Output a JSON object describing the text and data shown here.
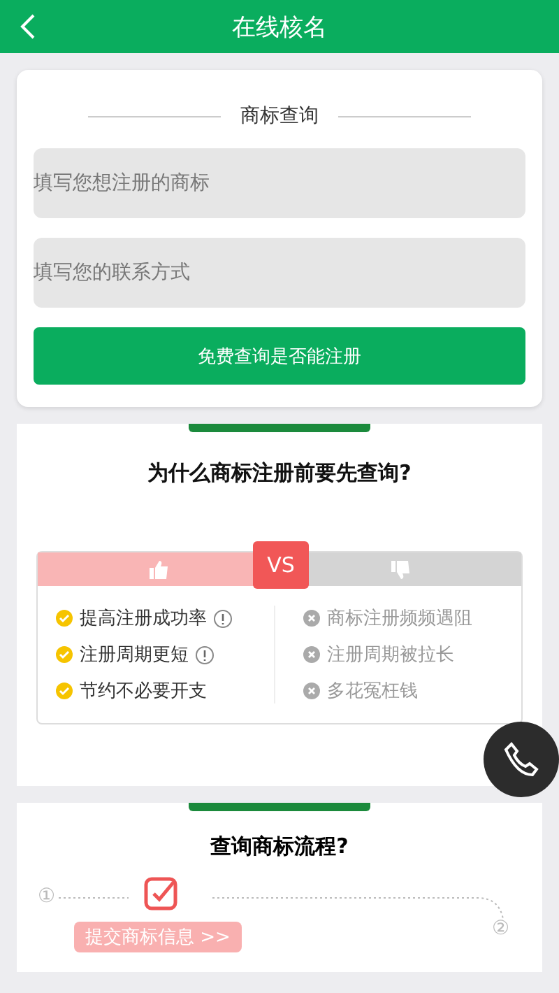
{
  "header": {
    "title": "在线核名"
  },
  "query_card": {
    "title": "商标查询",
    "fields": [
      {
        "placeholder": "填写您想注册的商标"
      },
      {
        "placeholder": "填写您的联系方式"
      }
    ],
    "button": "免费查询是否能注册"
  },
  "why_card": {
    "title": "为什么商标注册前要先查询?",
    "vs": "VS",
    "pros": [
      {
        "text": "提高注册成功率",
        "info": true
      },
      {
        "text": "注册周期更短",
        "info": true
      },
      {
        "text": "节约不必要开支",
        "info": false
      }
    ],
    "cons": [
      {
        "text": "商标注册频频遇阻"
      },
      {
        "text": "注册周期被拉长"
      },
      {
        "text": "多花冤枉钱"
      }
    ]
  },
  "flow_card": {
    "title": "查询商标流程?",
    "steps": [
      {
        "number": "①",
        "label": "提交商标信息 >>"
      },
      {
        "number": "②"
      }
    ]
  }
}
